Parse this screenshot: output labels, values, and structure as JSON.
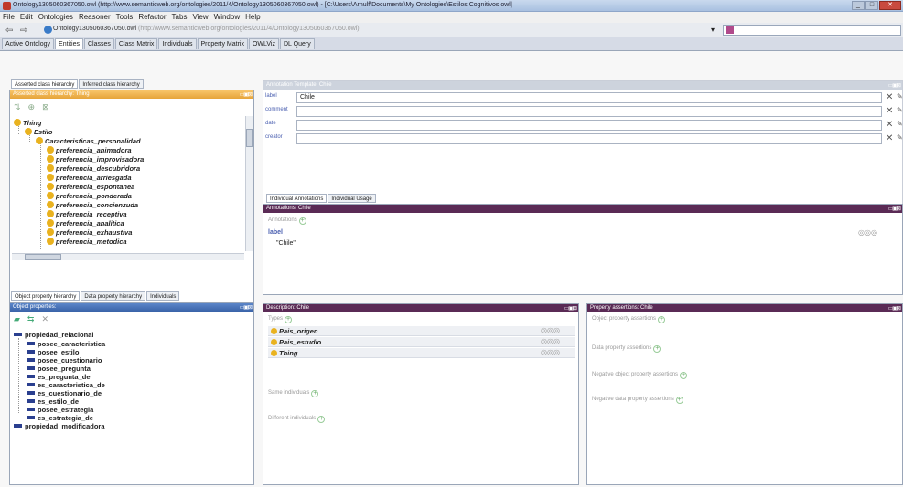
{
  "window": {
    "title": "Ontology1305060367050.owl (http://www.semanticweb.org/ontologies/2011/4/Ontology1305060367050.owl) - [C:\\Users\\Arnulf\\Documents\\My Ontologies\\Estilos Cognitivos.owl]"
  },
  "menu": [
    "File",
    "Edit",
    "Ontologies",
    "Reasoner",
    "Tools",
    "Refactor",
    "Tabs",
    "View",
    "Window",
    "Help"
  ],
  "address": {
    "ontology": "Ontology1305060367050.owl",
    "uri": "(http://www.semanticweb.org/ontologies/2011/4/Ontology1305060367050.owl)"
  },
  "tabs": [
    "Active Ontology",
    "Entities",
    "Classes",
    "Class Matrix",
    "Individuals",
    "Property Matrix",
    "OWLViz",
    "DL Query"
  ],
  "class_panel": {
    "subtabs": [
      "Asserted class hierarchy",
      "Inferred class hierarchy"
    ],
    "header": "Asserted class hierarchy: Thing",
    "tree": [
      {
        "label": "Thing",
        "level": 0
      },
      {
        "label": "Estilo",
        "level": 1
      },
      {
        "label": "Caracteristicas_personalidad",
        "level": 2
      },
      {
        "label": "preferencia_animadora",
        "level": 3
      },
      {
        "label": "preferencia_improvisadora",
        "level": 3
      },
      {
        "label": "preferencia_descubridora",
        "level": 3
      },
      {
        "label": "preferencia_arriesgada",
        "level": 3
      },
      {
        "label": "preferencia_espontanea",
        "level": 3
      },
      {
        "label": "preferencia_ponderada",
        "level": 3
      },
      {
        "label": "preferencia_concienzuda",
        "level": 3
      },
      {
        "label": "preferencia_receptiva",
        "level": 3
      },
      {
        "label": "preferencia_analitica",
        "level": 3
      },
      {
        "label": "preferencia_exhaustiva",
        "level": 3
      },
      {
        "label": "preferencia_metodica",
        "level": 3
      }
    ]
  },
  "prop_panel": {
    "subtabs": [
      "Object property hierarchy",
      "Data property hierarchy",
      "Individuals"
    ],
    "header": "Object properties:",
    "tree": [
      {
        "label": "propiedad_relacional",
        "level": 0
      },
      {
        "label": "posee_caracteristica",
        "level": 1
      },
      {
        "label": "posee_estilo",
        "level": 1
      },
      {
        "label": "posee_cuestionario",
        "level": 1
      },
      {
        "label": "posee_pregunta",
        "level": 1
      },
      {
        "label": "es_pregunta_de",
        "level": 1
      },
      {
        "label": "es_caracteristica_de",
        "level": 1
      },
      {
        "label": "es_cuestionario_de",
        "level": 1
      },
      {
        "label": "es_estilo_de",
        "level": 1
      },
      {
        "label": "posee_estrategia",
        "level": 1
      },
      {
        "label": "es_estrategia_de",
        "level": 1
      },
      {
        "label": "propiedad_modificadora",
        "level": 0
      }
    ]
  },
  "annotation_template": {
    "header": "Annotation Template: Chile",
    "rows": [
      {
        "label": "label",
        "value": "Chile"
      },
      {
        "label": "comment",
        "value": ""
      },
      {
        "label": "date",
        "value": ""
      },
      {
        "label": "creator",
        "value": ""
      }
    ]
  },
  "individual_annotations": {
    "subtabs": [
      "Individual Annotations",
      "Individual Usage"
    ],
    "header": "Annotations: Chile",
    "section_label": "Annotations",
    "label_key": "label",
    "label_value": "\"Chile\""
  },
  "description": {
    "header": "Description: Chile",
    "types_label": "Types",
    "types": [
      "Pais_origen",
      "Pais_estudio",
      "Thing"
    ],
    "same_label": "Same individuals",
    "different_label": "Different individuals"
  },
  "property_assertions": {
    "header": "Property assertions: Chile",
    "sections": [
      "Object property assertions",
      "Data property assertions",
      "Negative object property assertions",
      "Negative data property assertions"
    ]
  }
}
